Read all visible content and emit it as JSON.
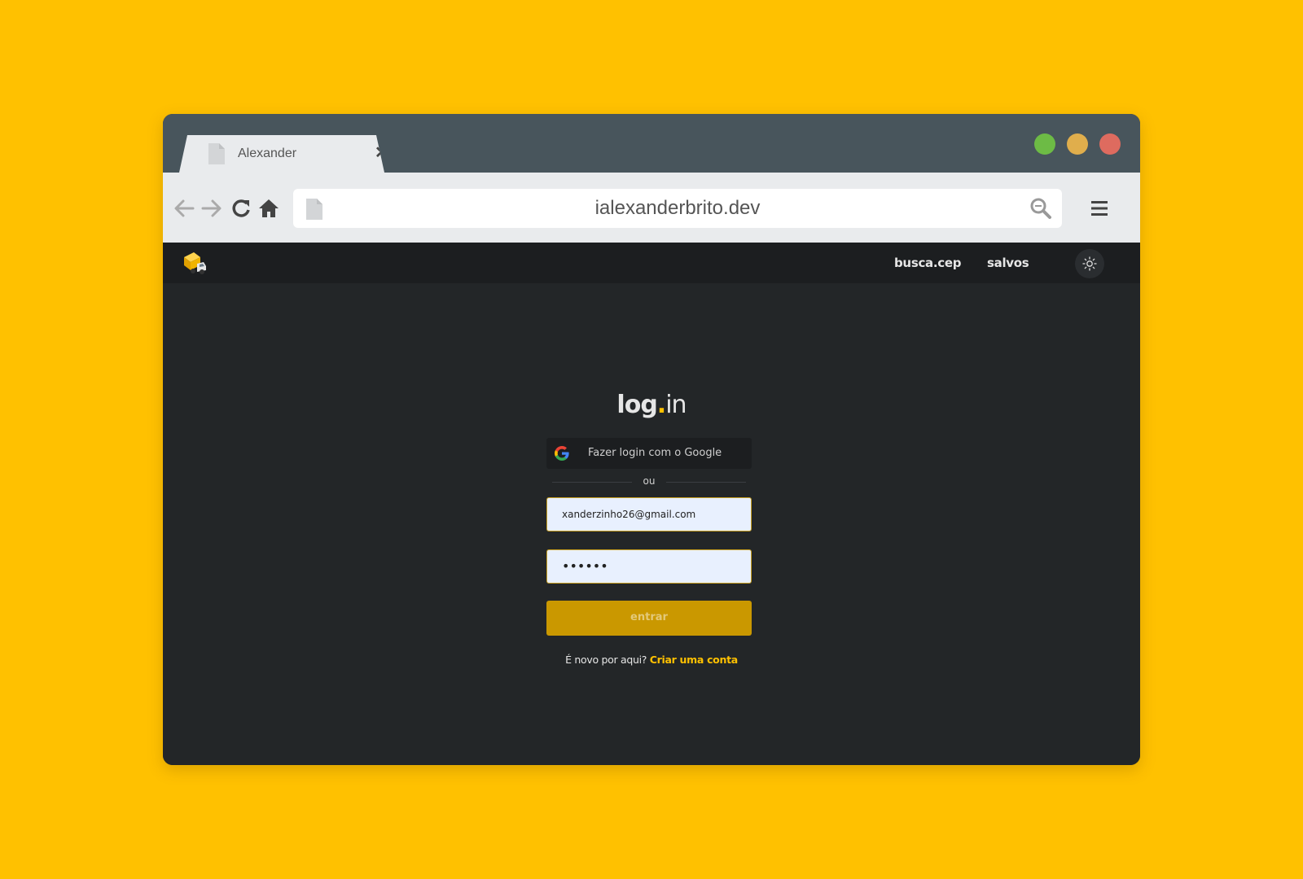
{
  "browser": {
    "tab_title": "Alexander",
    "tab_close": "✕",
    "url": "ialexanderbrito.dev",
    "window_controls": {
      "colors": [
        "#6DBB45",
        "#E0AE4C",
        "#DE6B5F"
      ]
    },
    "icons": [
      "back-arrow-icon",
      "forward-arrow-icon",
      "reload-icon",
      "home-icon",
      "document-icon",
      "search-icon",
      "hamburger-menu-icon"
    ]
  },
  "site_nav": {
    "logo_icon": "delivery-truck-icon",
    "links": [
      "busca.cep",
      "salvos"
    ],
    "theme_toggle_icon": "sun-icon"
  },
  "login": {
    "title_bold": "log",
    "title_dot": ".",
    "title_rest": "in",
    "google_button_label": "Fazer login com o Google",
    "divider_text": "ou",
    "email_value": "xanderzinho26@gmail.com",
    "password_mask": "••••••",
    "submit_label": "entrar",
    "signup_prompt": "É novo por aqui?",
    "signup_link": "Criar uma conta"
  },
  "colors": {
    "page_background": "#FFC100",
    "accent": "#FFC100",
    "button": "#CA9800",
    "content_background": "#232628"
  }
}
